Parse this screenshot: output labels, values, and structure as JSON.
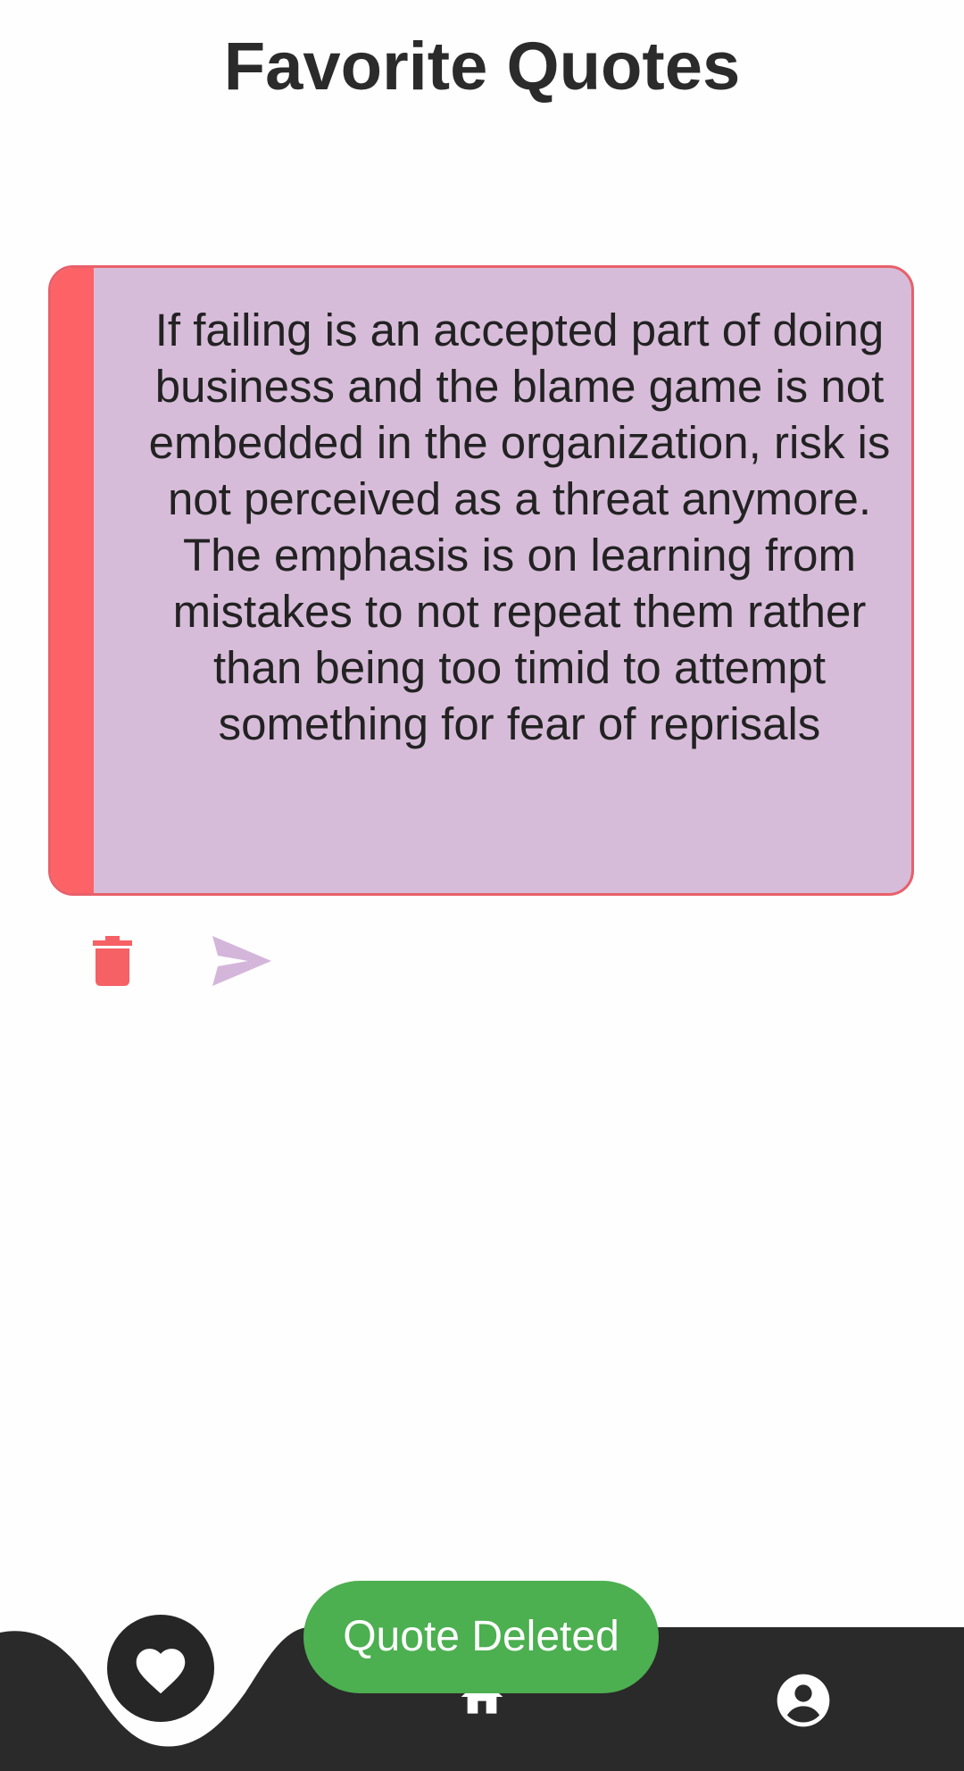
{
  "header": {
    "title": "Favorite Quotes"
  },
  "quote": {
    "text": "If failing is an accepted part of doing business and the blame game is not embedded in the organization, risk is not perceived as a threat anymore. The emphasis is on learning from mistakes to not repeat them rather than being too timid to attempt something for fear of reprisals"
  },
  "actions": {
    "delete_icon": "trash-icon",
    "share_icon": "send-icon"
  },
  "nav": {
    "items": [
      {
        "icon": "heart-icon",
        "active": true
      },
      {
        "icon": "home-icon",
        "active": false
      },
      {
        "icon": "account-circle-icon",
        "active": false
      }
    ]
  },
  "toast": {
    "message": "Quote Deleted"
  },
  "colors": {
    "card_background": "#d7bcd9",
    "card_accent": "#fd6366",
    "nav_background": "#2a2a2a",
    "toast_background": "#4caf50",
    "delete_icon": "#f56165",
    "share_icon": "#d5b6db"
  }
}
